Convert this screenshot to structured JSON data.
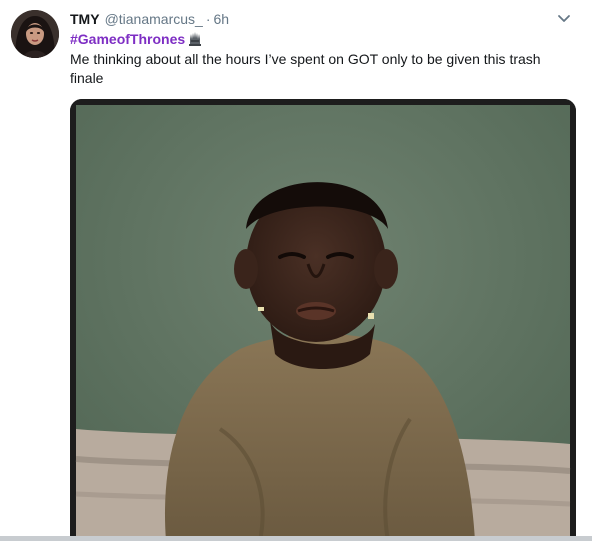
{
  "tweet": {
    "display_name": "TMY",
    "handle": "@tianamarcus_",
    "separator": "·",
    "time": "6h",
    "hashtag": "#GameofThrones",
    "text": "Me thinking about all the hours I’ve spent on GOT only to be given this trash finale",
    "icons": {
      "caret": "chevron-down-icon",
      "hashflag": "iron-throne-hashflag-icon"
    },
    "colors": {
      "hashtag": "#7e2ec4",
      "name": "#14171a",
      "secondary": "#657786"
    }
  }
}
